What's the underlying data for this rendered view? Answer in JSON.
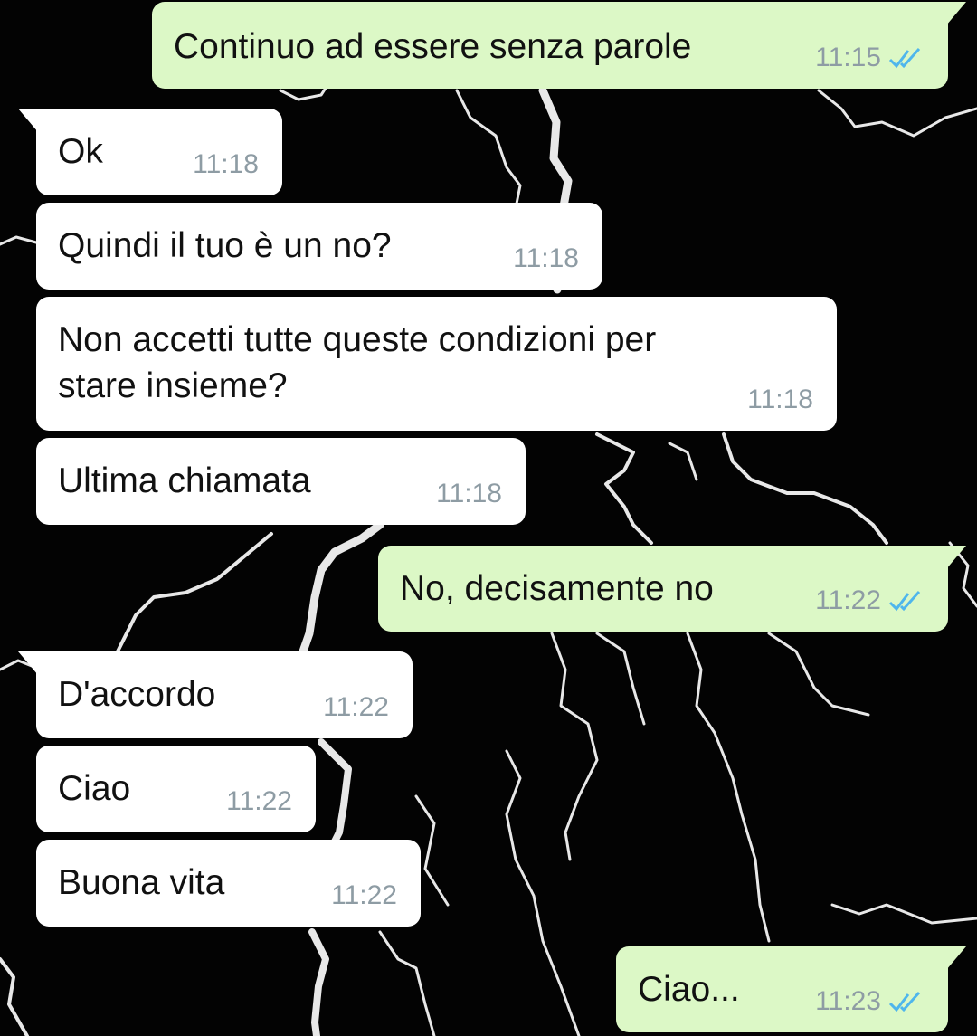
{
  "colors": {
    "incoming_bubble": "#ffffff",
    "outgoing_bubble": "#dcf8c6",
    "timestamp": "#8e9ca4",
    "read_ticks": "#4fb6ec",
    "wallpaper": "#000000"
  },
  "messages": [
    {
      "direction": "outgoing",
      "text": "Continuo ad essere senza parole",
      "time": "11:15",
      "status_icon": "double-check-read-icon"
    },
    {
      "direction": "incoming",
      "text": "Ok",
      "time": "11:18"
    },
    {
      "direction": "incoming",
      "text": "Quindi il tuo è un no?",
      "time": "11:18"
    },
    {
      "direction": "incoming",
      "text": "Non accetti tutte queste condizioni per\nstare insieme?",
      "time": "11:18"
    },
    {
      "direction": "incoming",
      "text": "Ultima chiamata",
      "time": "11:18"
    },
    {
      "direction": "outgoing",
      "text": "No, decisamente no",
      "time": "11:22",
      "status_icon": "double-check-read-icon"
    },
    {
      "direction": "incoming",
      "text": "D'accordo",
      "time": "11:22"
    },
    {
      "direction": "incoming",
      "text": "Ciao",
      "time": "11:22"
    },
    {
      "direction": "incoming",
      "text": "Buona vita",
      "time": "11:22"
    },
    {
      "direction": "outgoing",
      "text": "Ciao...",
      "time": "11:23",
      "status_icon": "double-check-read-icon"
    }
  ]
}
